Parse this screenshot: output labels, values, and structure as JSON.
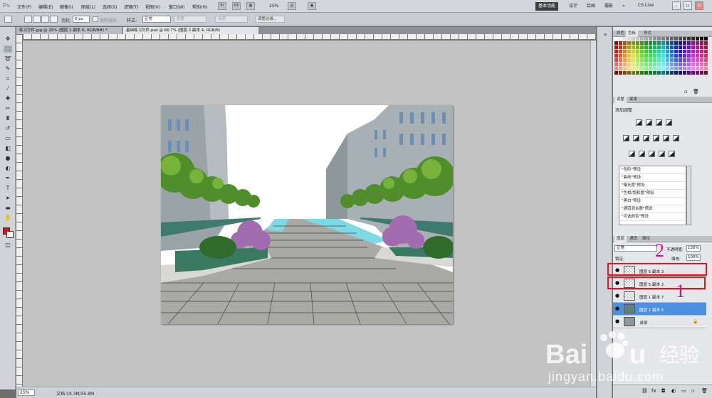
{
  "app": {
    "logo": "Ps"
  },
  "menu": [
    "文件(F)",
    "编辑(E)",
    "图像(I)",
    "图层(L)",
    "选择(S)",
    "滤镜(T)",
    "视图(V)",
    "窗口(W)",
    "帮助(H)"
  ],
  "menubar": {
    "icon1": "Br",
    "icon2": "Mb",
    "zoom": "25%"
  },
  "workspaces": [
    "基本功能",
    "设计",
    "绘画",
    "摄影"
  ],
  "cslive": "CS Live",
  "options": {
    "feather_label": "羽化:",
    "feather_value": "0 px",
    "antialias": "消除锯齿",
    "style_label": "样式:",
    "style_value": "正常",
    "width": "宽度",
    "height": "高度",
    "refine_edge": "调整边缘..."
  },
  "tabs": [
    "练习文件.jpg @ 25% (图层 1 副本 6, RGB/8#) *",
    "基础练习文件.psd @ 66.7% (图层 2 副本 4, RGB/8)"
  ],
  "status": {
    "zoom": "25%",
    "doc": "文档:19.3M/35.8M"
  },
  "swatches_panel": {
    "tabs": [
      "颜色",
      "色板",
      "样式"
    ]
  },
  "adjustments_panel": {
    "tabs": [
      "调整",
      "蒙版"
    ],
    "title": "添加调整",
    "presets": [
      "\"色阶\"预设",
      "\"曲线\"预设",
      "\"曝光度\"预设",
      "\"色相/饱和度\"预设",
      "\"黑白\"预设",
      "\"通道混合器\"预设",
      "\"可选颜色\"预设"
    ]
  },
  "layers_panel": {
    "tabs": [
      "图层",
      "通道",
      "路径"
    ],
    "blend_mode": "正常",
    "opacity_label": "不透明度:",
    "opacity": "100%",
    "lock_label": "锁定:",
    "fill_label": "填充:",
    "fill": "100%",
    "layers": [
      {
        "name": "图层 5 副本 3",
        "selected": false
      },
      {
        "name": "图层 5 副本 2",
        "selected": false
      },
      {
        "name": "图层 1 副本 7",
        "selected": false
      },
      {
        "name": "图层 1 副本 6",
        "selected": true
      },
      {
        "name": "背景",
        "selected": false
      }
    ]
  },
  "annotations": [
    "2",
    "1"
  ],
  "watermark": {
    "url": "jingyan.baidu.com"
  },
  "colors": {
    "selected_layer": "#4d8fe0",
    "annotation_box": "#e8141e",
    "annotation_number": "#d2108a",
    "foreground": "#e4100f"
  }
}
